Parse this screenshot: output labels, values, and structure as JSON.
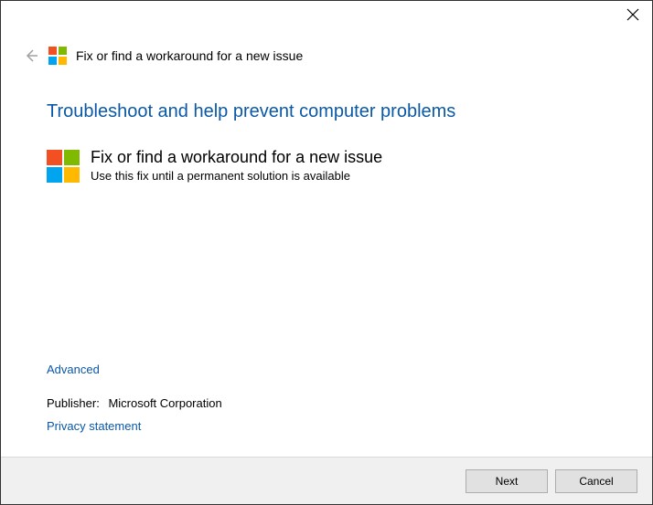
{
  "header": {
    "title": "Fix or find a workaround for a new issue"
  },
  "main": {
    "heading": "Troubleshoot and help prevent computer problems",
    "item": {
      "title": "Fix or find a workaround for a new issue",
      "subtitle": "Use this fix until a permanent solution is available"
    }
  },
  "lower": {
    "advanced": "Advanced",
    "publisher_label": "Publisher:",
    "publisher_value": "Microsoft Corporation",
    "privacy": "Privacy statement"
  },
  "footer": {
    "next": "Next",
    "cancel": "Cancel"
  },
  "colors": {
    "ms_red": "#f25022",
    "ms_green": "#7fba00",
    "ms_blue": "#00a4ef",
    "ms_yellow": "#ffb900"
  }
}
